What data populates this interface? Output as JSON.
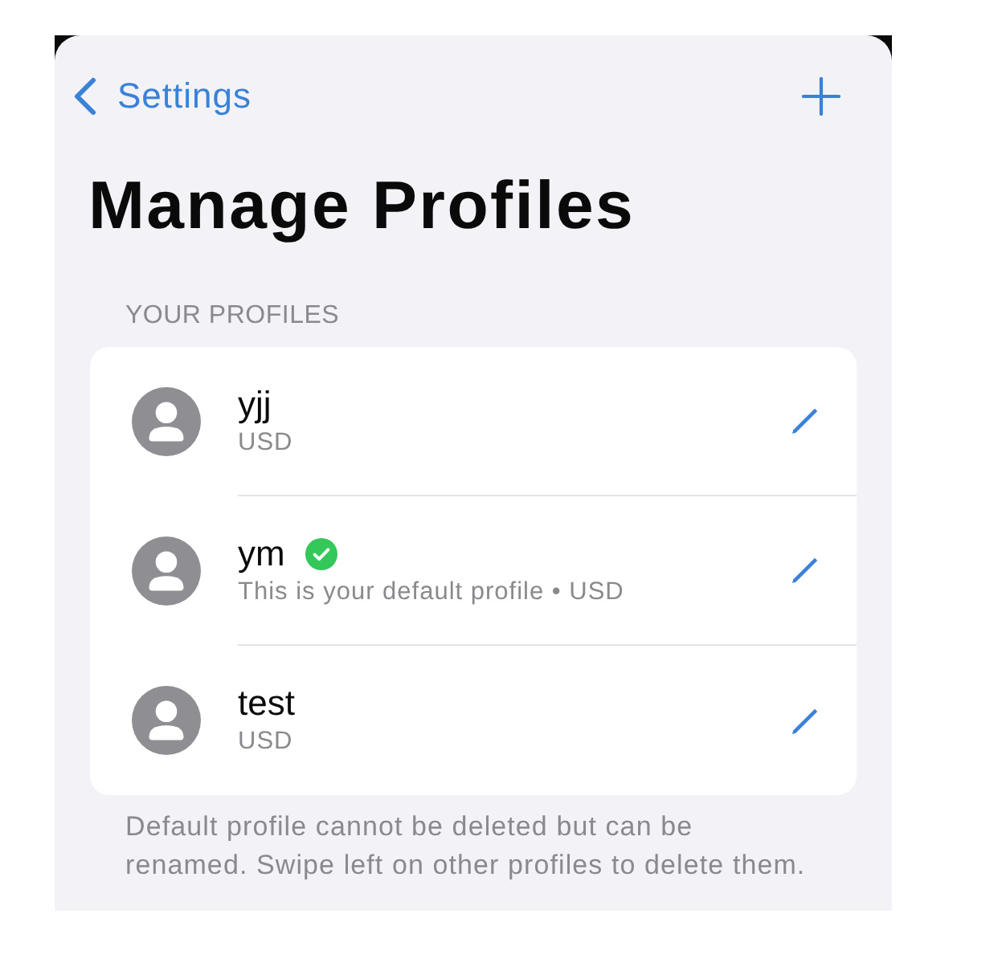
{
  "nav": {
    "back_label": "Settings"
  },
  "title": "Manage Profiles",
  "section_header": "YOUR PROFILES",
  "profiles": [
    {
      "name": "yjj",
      "subtitle": "USD",
      "default": false
    },
    {
      "name": "ym",
      "subtitle": "This is your default profile • USD",
      "default": true
    },
    {
      "name": "test",
      "subtitle": "USD",
      "default": false
    }
  ],
  "footer": "Default profile cannot be deleted but can be renamed. Swipe left on other profiles to delete them."
}
